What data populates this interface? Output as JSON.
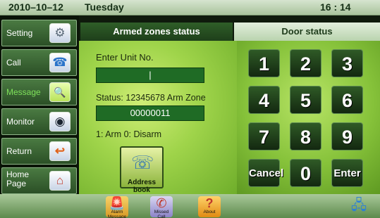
{
  "status_bar": {
    "date": "2010–10–12",
    "day": "Tuesday",
    "time": "16 : 14"
  },
  "sidebar": {
    "items": [
      {
        "label": "Setting",
        "icon": "gear-icon",
        "glyph": "⚙",
        "active": false
      },
      {
        "label": "Call",
        "icon": "phone-icon",
        "glyph": "☎",
        "active": false
      },
      {
        "label": "Message",
        "icon": "magnifier-icon",
        "glyph": "🔍",
        "active": true
      },
      {
        "label": "Monitor",
        "icon": "camera-icon",
        "glyph": "◉",
        "active": false
      },
      {
        "label": "Return",
        "icon": "return-arrow-icon",
        "glyph": "↩",
        "active": false
      },
      {
        "label_line1": "Home",
        "label_line2": "Page",
        "icon": "house-icon",
        "glyph": "⌂",
        "active": false
      }
    ]
  },
  "tabs": {
    "armed": "Armed zones status",
    "door": "Door status"
  },
  "form": {
    "enter_label": "Enter Unit No.",
    "unit_value": "|",
    "status_label": "Status: 12345678 Arm Zone",
    "status_value": "00000011",
    "legend": "1: Arm  0: Disarm",
    "address_book": {
      "label": "Address book",
      "icon": "address-book-icon",
      "glyph": "☏"
    }
  },
  "keypad": {
    "keys": [
      "1",
      "2",
      "3",
      "4",
      "5",
      "6",
      "7",
      "8",
      "9",
      "Cancel",
      "0",
      "Enter"
    ]
  },
  "bottom_bar": {
    "alarm": {
      "label": "Alarm Message",
      "icon": "alarm-light-icon",
      "glyph": "🚨"
    },
    "missed": {
      "label": "Missed Call",
      "icon": "missed-call-icon",
      "glyph": "✆"
    },
    "about": {
      "label": "About",
      "icon": "question-mark-icon",
      "glyph": "?"
    },
    "network": {
      "icon": "network-computers-icon",
      "glyph": "🖧"
    }
  },
  "colors": {
    "accent_green": "#1f6b25",
    "active_text": "#7ee05a",
    "panel_green": "#9fd44a"
  }
}
